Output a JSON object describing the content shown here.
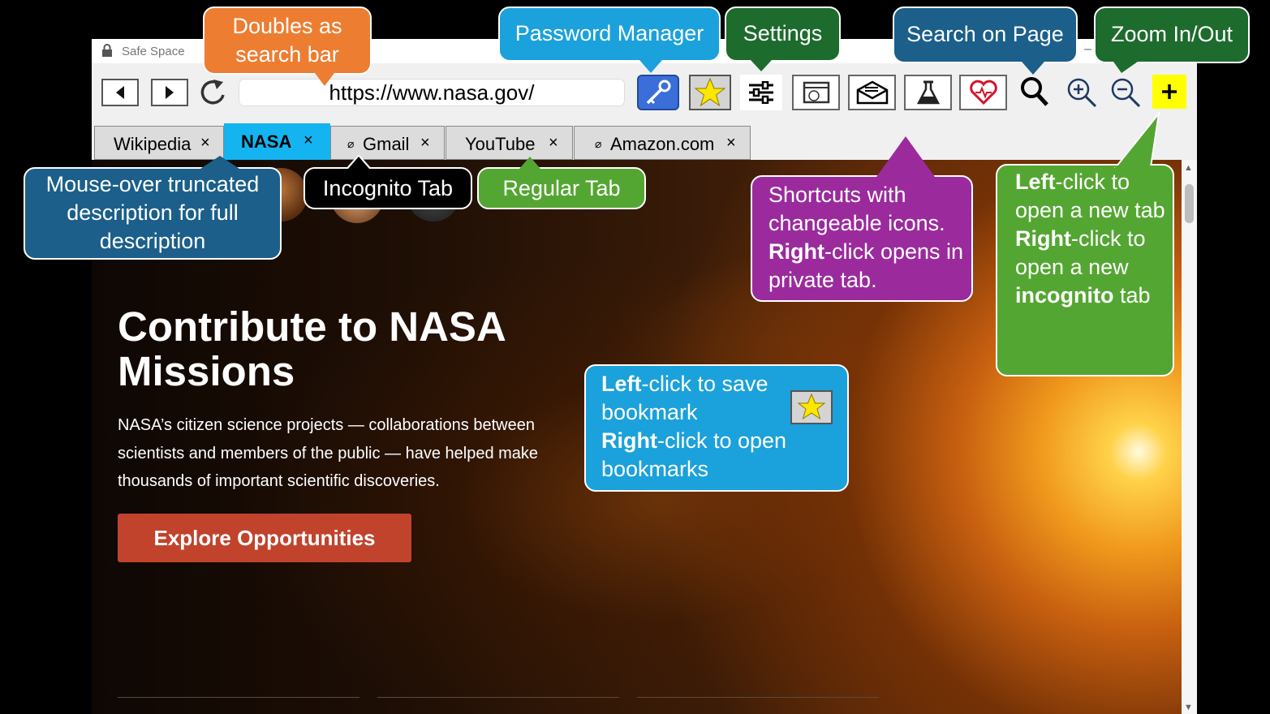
{
  "window": {
    "title": "Safe Space"
  },
  "toolbar": {
    "back_icon": "triangle-left-icon",
    "forward_icon": "triangle-right-icon",
    "reload_icon": "reload-icon",
    "url": "https://www.nasa.gov/",
    "buttons": [
      "key-icon",
      "star-icon",
      "sliders-icon",
      "browser-window-icon",
      "envelope-icon",
      "flask-icon",
      "heart-icon",
      "search-icon",
      "zoom-in-icon",
      "zoom-out-icon",
      "plus-icon"
    ]
  },
  "tabs": [
    {
      "label": "Wikipedia",
      "close": "×",
      "incognito": false,
      "active": false
    },
    {
      "label": "NASA",
      "close": "×",
      "incognito": false,
      "active": true
    },
    {
      "label": "Gmail",
      "close": "×",
      "incognito": true,
      "active": false
    },
    {
      "label": "YouTube",
      "close": "×",
      "incognito": false,
      "active": false
    },
    {
      "label": "Amazon.com",
      "close": "×",
      "incognito": true,
      "active": false
    }
  ],
  "incognito_glyph": "⌀",
  "page": {
    "hero_title": "Contribute to NASA Missions",
    "hero_text": "NASA’s citizen science projects — collaborations between scientists and members of the public — have helped make thousands of important scientific discoveries.",
    "hero_button": "Explore Opportunities"
  },
  "callouts": {
    "search_bar": "Doubles as search bar",
    "password_manager": "Password Manager",
    "settings": "Settings",
    "search_page": "Search on Page",
    "zoom": "Zoom In/Out",
    "mouse_over": "Mouse-over truncated description for full description",
    "incognito_tab": "Incognito Tab",
    "regular_tab": "Regular Tab",
    "shortcuts": {
      "line1": "Shortcuts with changeable icons.",
      "bold": "Right",
      "line2": "-click opens in private tab."
    },
    "bookmark": {
      "b1": "Left",
      "t1": "-click to save bookmark",
      "b2": "Right",
      "t2": "-click to open bookmarks"
    },
    "new_tab": {
      "b1": "Left",
      "t1": "-click to open a new tab",
      "b2": "Right",
      "t2": "-click to open a new",
      "b3": "incognito",
      "t3": "tab"
    }
  },
  "colors": {
    "orange": "#ed7d31",
    "blue": "#1ba1db",
    "dark_green": "#1e6b2e",
    "teal": "#1b5f8a",
    "green": "#54a632",
    "purple": "#9b2b9d",
    "active_tab": "#14b4f0",
    "plus_bg": "#ffff00"
  }
}
